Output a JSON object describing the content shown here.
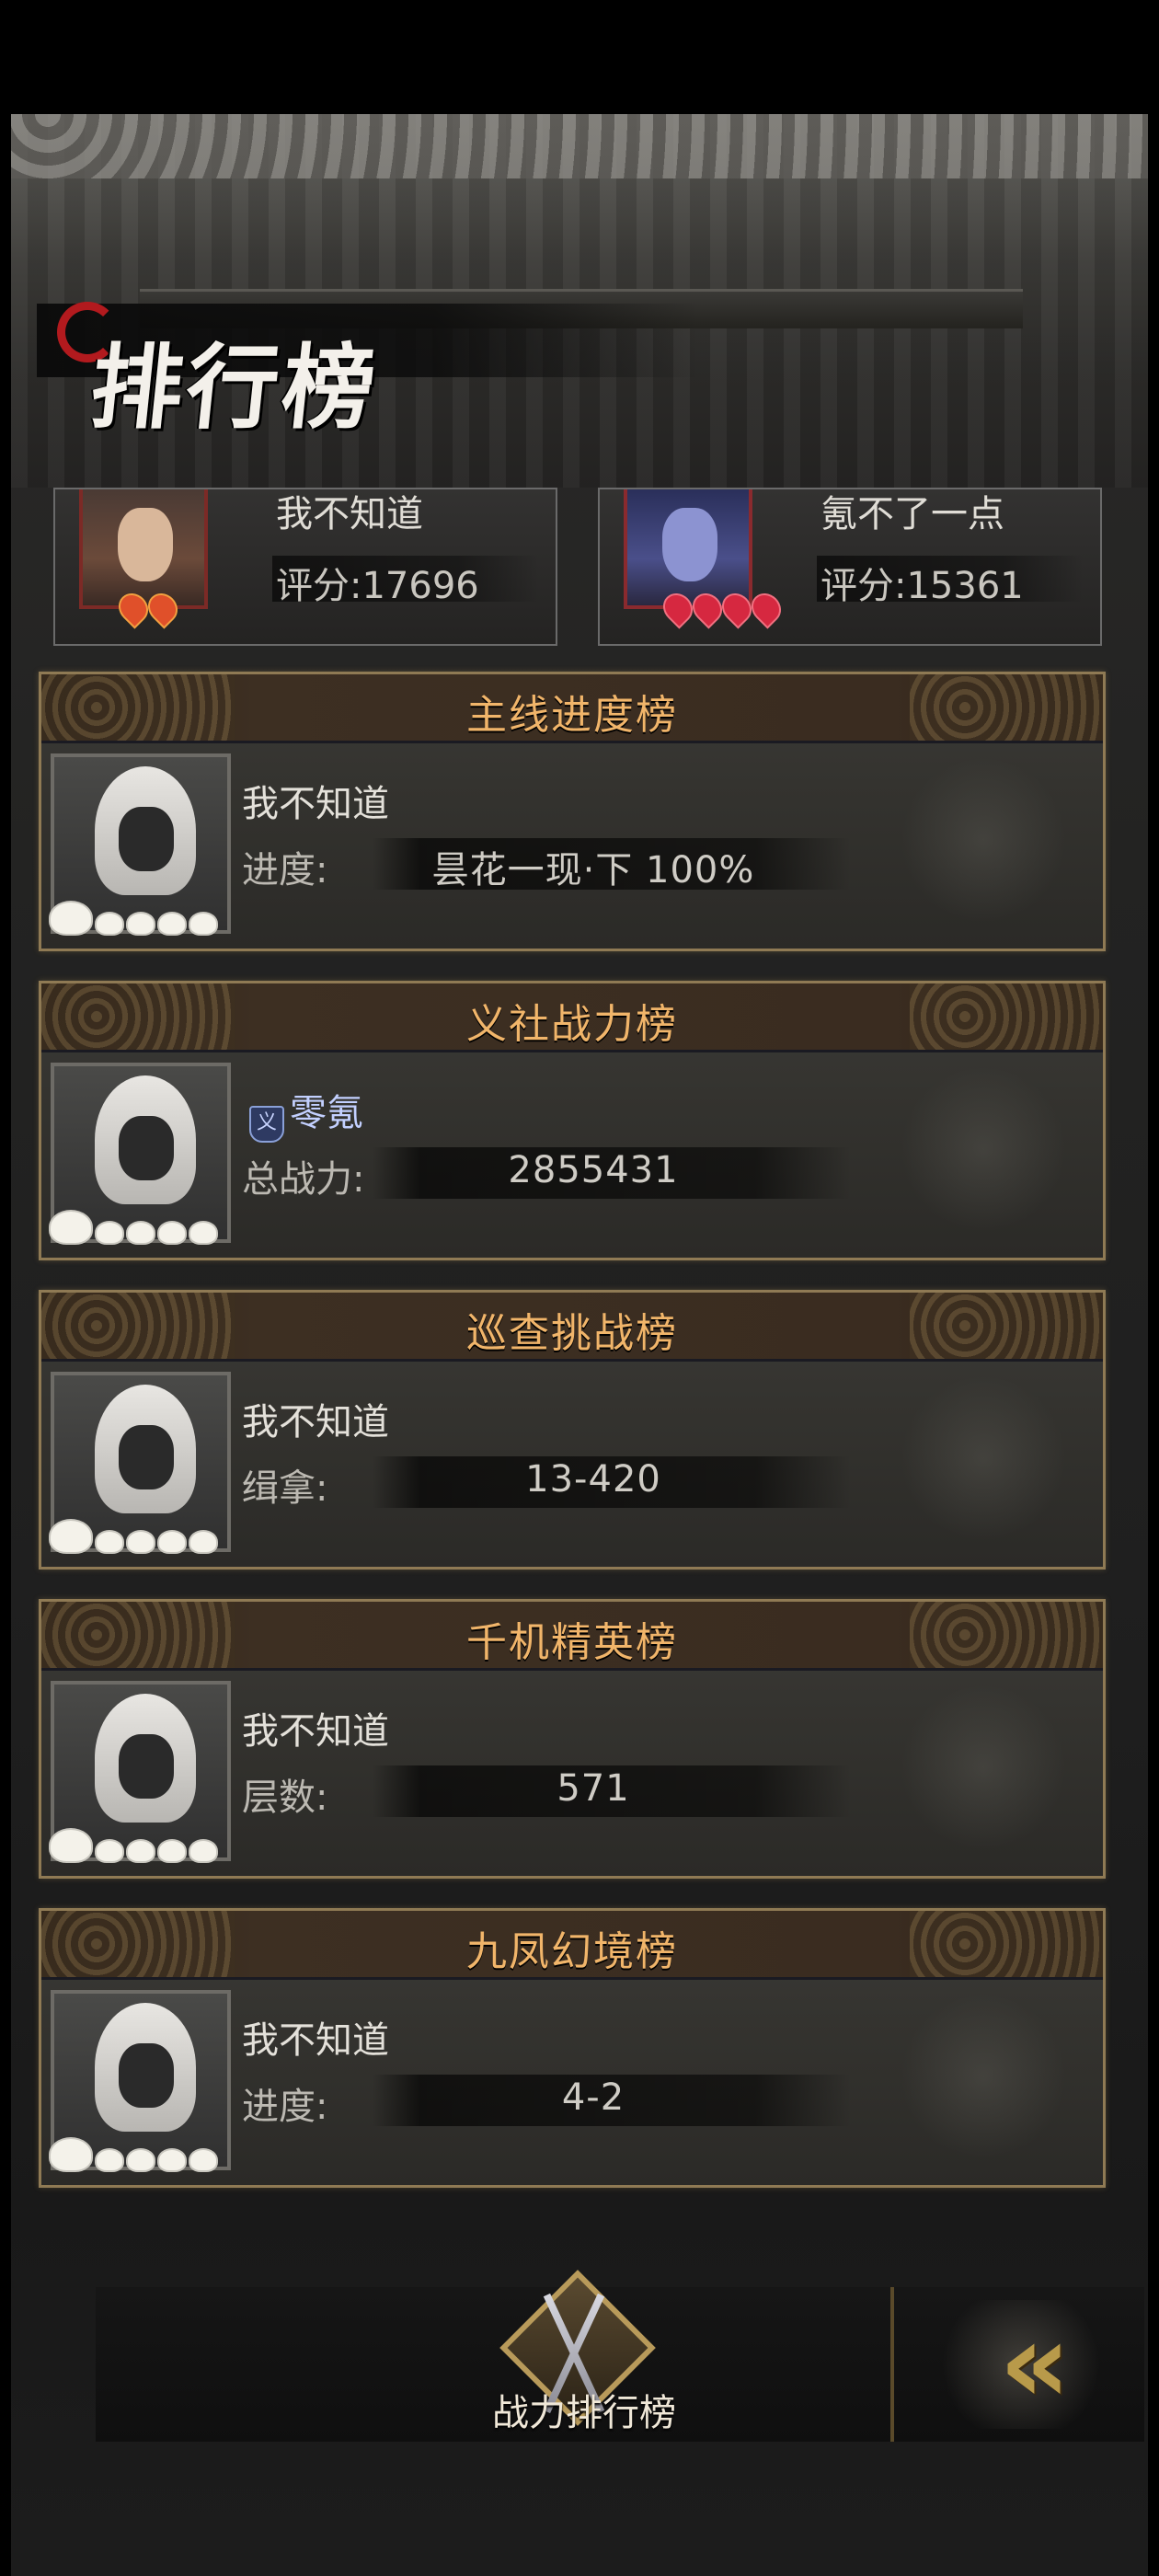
{
  "title": "排行榜",
  "top_ranks": [
    {
      "name": "我不知道",
      "score": "评分:17696"
    },
    {
      "name": "氪不了一点",
      "score": "评分:15361"
    }
  ],
  "boards": [
    {
      "title": "主线进度榜",
      "name": "我不知道",
      "label": "进度:",
      "value": "昙花一现·下  100%"
    },
    {
      "title": "义社战力榜",
      "name": "零氪",
      "badge": "义",
      "label": "总战力:",
      "value": "2855431"
    },
    {
      "title": "巡查挑战榜",
      "name": "我不知道",
      "label": "缉拿:",
      "value": "13-420"
    },
    {
      "title": "千机精英榜",
      "name": "我不知道",
      "label": "层数:",
      "value": "571"
    },
    {
      "title": "九凤幻境榜",
      "name": "我不知道",
      "label": "进度:",
      "value": "4-2"
    }
  ],
  "bottom": {
    "power_rank_label": "战力排行榜",
    "back_icon": "double-chevron-left-icon"
  }
}
